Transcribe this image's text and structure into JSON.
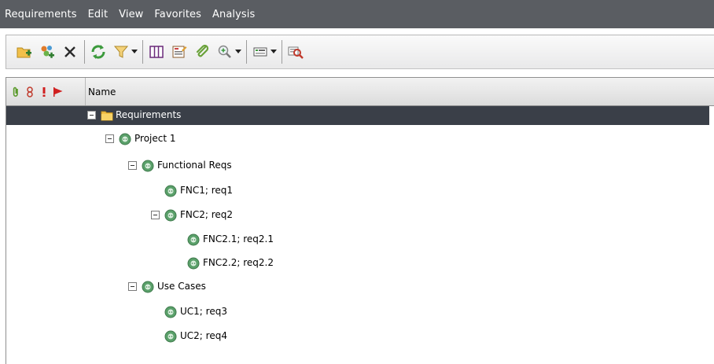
{
  "menu": {
    "items": [
      "Requirements",
      "Edit",
      "View",
      "Favorites",
      "Analysis"
    ]
  },
  "toolbar": {
    "buttons": [
      {
        "name": "new-folder-icon"
      },
      {
        "name": "new-requirement-icon"
      },
      {
        "name": "delete-icon"
      },
      {
        "name": "refresh-icon"
      },
      {
        "name": "filter-icon"
      },
      {
        "name": "columns-icon"
      },
      {
        "name": "details-icon"
      },
      {
        "name": "attachment-icon"
      },
      {
        "name": "zoom-icon"
      },
      {
        "name": "view-icon"
      },
      {
        "name": "analysis-icon"
      }
    ]
  },
  "grid": {
    "header": {
      "icons": [
        "attachment-column-icon",
        "link-column-icon",
        "alert-column-icon",
        "flag-column-icon"
      ],
      "name_label": "Name"
    },
    "rows": [
      {
        "label": "Requirements",
        "type": "folder",
        "expandable": true,
        "selected": true,
        "depth": 0
      },
      {
        "label": "Project 1",
        "type": "requirement",
        "expandable": true,
        "selected": false,
        "depth": 1
      },
      {
        "label": "Functional Reqs",
        "type": "requirement",
        "expandable": true,
        "selected": false,
        "depth": 2
      },
      {
        "label": "FNC1; req1",
        "type": "requirement",
        "expandable": false,
        "selected": false,
        "depth": 3
      },
      {
        "label": "FNC2; req2",
        "type": "requirement",
        "expandable": true,
        "selected": false,
        "depth": 3
      },
      {
        "label": "FNC2.1; req2.1",
        "type": "requirement",
        "expandable": false,
        "selected": false,
        "depth": 4
      },
      {
        "label": "FNC2.2; req2.2",
        "type": "requirement",
        "expandable": false,
        "selected": false,
        "depth": 4
      },
      {
        "label": "Use Cases",
        "type": "requirement",
        "expandable": true,
        "selected": false,
        "depth": 2
      },
      {
        "label": "UC1; req3",
        "type": "requirement",
        "expandable": false,
        "selected": false,
        "depth": 3
      },
      {
        "label": "UC2; req4",
        "type": "requirement",
        "expandable": false,
        "selected": false,
        "depth": 3
      }
    ]
  },
  "colors": {
    "menubar": "#5a5d62",
    "selected_row": "#3a3f48",
    "folder": "#f2c04a",
    "requirement_status": "#5aa06a"
  }
}
